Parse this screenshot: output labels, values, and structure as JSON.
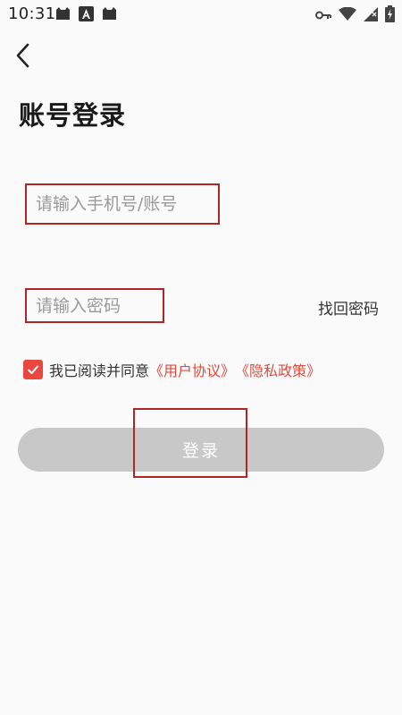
{
  "status_bar": {
    "time": "10:31",
    "notification_icons": [
      "cat-app-icon",
      "app-store-a-icon",
      "cat-app-icon"
    ],
    "system_icons": [
      "vpn-key-icon",
      "wifi-icon",
      "signal-icon",
      "battery-charging-icon"
    ]
  },
  "nav": {
    "back_icon": "back-arrow-icon"
  },
  "page": {
    "title": "账号登录"
  },
  "form": {
    "account_placeholder": "请输入手机号/账号",
    "password_placeholder": "请输入密码",
    "forgot_password": "找回密码",
    "agreement": {
      "checked": true,
      "prefix": "我已阅读并同意",
      "user_agreement": "《用户协议》",
      "privacy_policy": "《隐私政策》"
    },
    "login_label": "登录"
  },
  "colors": {
    "accent": "#e24a3b",
    "checkbox": "#e8483f",
    "button_disabled": "#c8c8c8",
    "highlight_box": "#b32525"
  }
}
